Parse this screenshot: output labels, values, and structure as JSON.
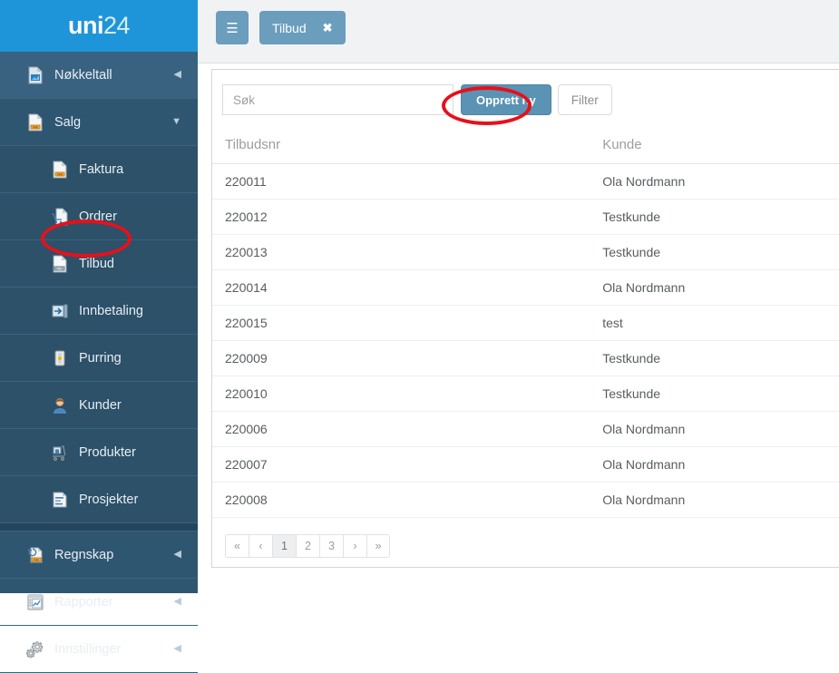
{
  "brand": {
    "bold": "uni",
    "light": "24"
  },
  "topbar": {
    "burger_icon": "hamburger-icon",
    "tab_label": "Tilbud",
    "tab_close": "✖"
  },
  "sidebar": {
    "items": [
      {
        "label": "Nøkkeltall",
        "icon": "chart-document-icon",
        "level": "top",
        "caret": "◀",
        "active": true
      },
      {
        "label": "Salg",
        "icon": "invoice-document-icon",
        "level": "top",
        "caret": "▼",
        "active": false
      },
      {
        "label": "Faktura",
        "icon": "invoice-document-icon",
        "level": "sub",
        "caret": "",
        "active": false
      },
      {
        "label": "Ordrer",
        "icon": "cart-document-icon",
        "level": "sub",
        "caret": "",
        "active": false
      },
      {
        "label": "Tilbud",
        "icon": "offer-document-icon",
        "level": "sub",
        "caret": "",
        "active": false
      },
      {
        "label": "Innbetaling",
        "icon": "payment-in-icon",
        "level": "sub",
        "caret": "",
        "active": false
      },
      {
        "label": "Purring",
        "icon": "traffic-light-icon",
        "level": "sub",
        "caret": "",
        "active": false
      },
      {
        "label": "Kunder",
        "icon": "customer-icon",
        "level": "sub",
        "caret": "",
        "active": false
      },
      {
        "label": "Produkter",
        "icon": "products-cart-icon",
        "level": "sub",
        "caret": "",
        "active": false
      },
      {
        "label": "Prosjekter",
        "icon": "projects-chart-icon",
        "level": "sub",
        "caret": "",
        "active": false
      },
      {
        "label": "Regnskap",
        "icon": "accounting-icon",
        "level": "top",
        "caret": "◀",
        "active": false
      },
      {
        "label": "Rapporter",
        "icon": "reports-icon",
        "level": "top",
        "caret": "◀",
        "active": false
      },
      {
        "label": "Innstillinger",
        "icon": "gears-icon",
        "level": "top",
        "caret": "◀",
        "active": false
      }
    ]
  },
  "toolbar": {
    "search_placeholder": "Søk",
    "search_value": "",
    "create_label": "Opprett ny",
    "filter_label": "Filter"
  },
  "table": {
    "columns": [
      "Tilbudsnr",
      "Kunde"
    ],
    "rows": [
      [
        "220011",
        "Ola Nordmann"
      ],
      [
        "220012",
        "Testkunde"
      ],
      [
        "220013",
        "Testkunde"
      ],
      [
        "220014",
        "Ola Nordmann"
      ],
      [
        "220015",
        "test"
      ],
      [
        "220009",
        "Testkunde"
      ],
      [
        "220010",
        "Testkunde"
      ],
      [
        "220006",
        "Ola Nordmann"
      ],
      [
        "220007",
        "Ola Nordmann"
      ],
      [
        "220008",
        "Ola Nordmann"
      ]
    ]
  },
  "pagination": {
    "items": [
      "«",
      "‹",
      "1",
      "2",
      "3",
      "›",
      "»"
    ],
    "active_index": 2
  },
  "annotations": {
    "highlight_color": "#e8101a",
    "targets": [
      "Tilbud",
      "Opprett ny"
    ]
  },
  "colors": {
    "brand_blue": "#1e95d9",
    "sidebar": "#2f5671",
    "accent_button": "#5a93b4",
    "topbar_bg": "#f1f2f4"
  }
}
